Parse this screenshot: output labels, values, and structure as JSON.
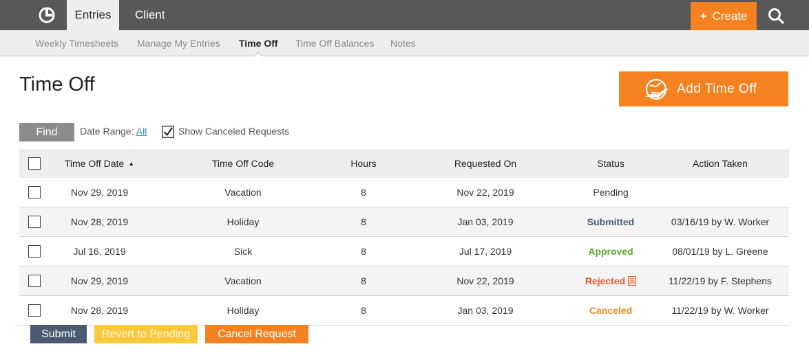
{
  "topbar": {
    "tabs": [
      "Entries",
      "Client"
    ],
    "create_label": "Create",
    "create_icon": "plus-icon",
    "search_icon": "search-icon",
    "logo_icon": "logo-icon",
    "accent_color": "#f58220",
    "bar_color": "#585858"
  },
  "subnav": {
    "items": [
      "Weekly Timesheets",
      "Manage My Entries",
      "Time Off",
      "Time Off Balances",
      "Notes"
    ],
    "active": "Time Off"
  },
  "page": {
    "title": "Time Off",
    "add_button": "Add Time Off",
    "add_icon": "globe-plane-icon"
  },
  "filters": {
    "find_label": "Find",
    "date_range_label": "Date Range:",
    "date_range_value": "All",
    "show_canceled_label": "Show Canceled Requests",
    "show_canceled_checked": true
  },
  "table": {
    "columns": [
      "Time Off Date",
      "Time Off Code",
      "Hours",
      "Requested On",
      "Status",
      "Action Taken"
    ],
    "sorted_column": "Time Off Date",
    "sort_direction": "ascending",
    "rows": [
      {
        "date": "Nov 29, 2019",
        "code": "Vacation",
        "hours": "8",
        "requested": "Nov 22, 2019",
        "status": "Pending",
        "action": ""
      },
      {
        "date": "Nov 28, 2019",
        "code": "Holiday",
        "hours": "8",
        "requested": "Jan 03, 2019",
        "status": "Submitted",
        "action": "03/16/19 by W. Worker"
      },
      {
        "date": "Jul 16, 2019",
        "code": "Sick",
        "hours": "8",
        "requested": "Jul 17, 2019",
        "status": "Approved",
        "action": "08/01/19 by L. Greene"
      },
      {
        "date": "Nov 29, 2019",
        "code": "Vacation",
        "hours": "8",
        "requested": "Nov 22, 2019",
        "status": "Rejected",
        "action": "11/22/19 by F. Stephens"
      },
      {
        "date": "Nov 28, 2019",
        "code": "Holiday",
        "hours": "8",
        "requested": "Jan 03, 2019",
        "status": "Canceled",
        "action": "11/22/19 by W. Worker"
      }
    ]
  },
  "actions": {
    "submit": "Submit",
    "revert": "Revert to Pending",
    "cancel": "Cancel Request"
  }
}
